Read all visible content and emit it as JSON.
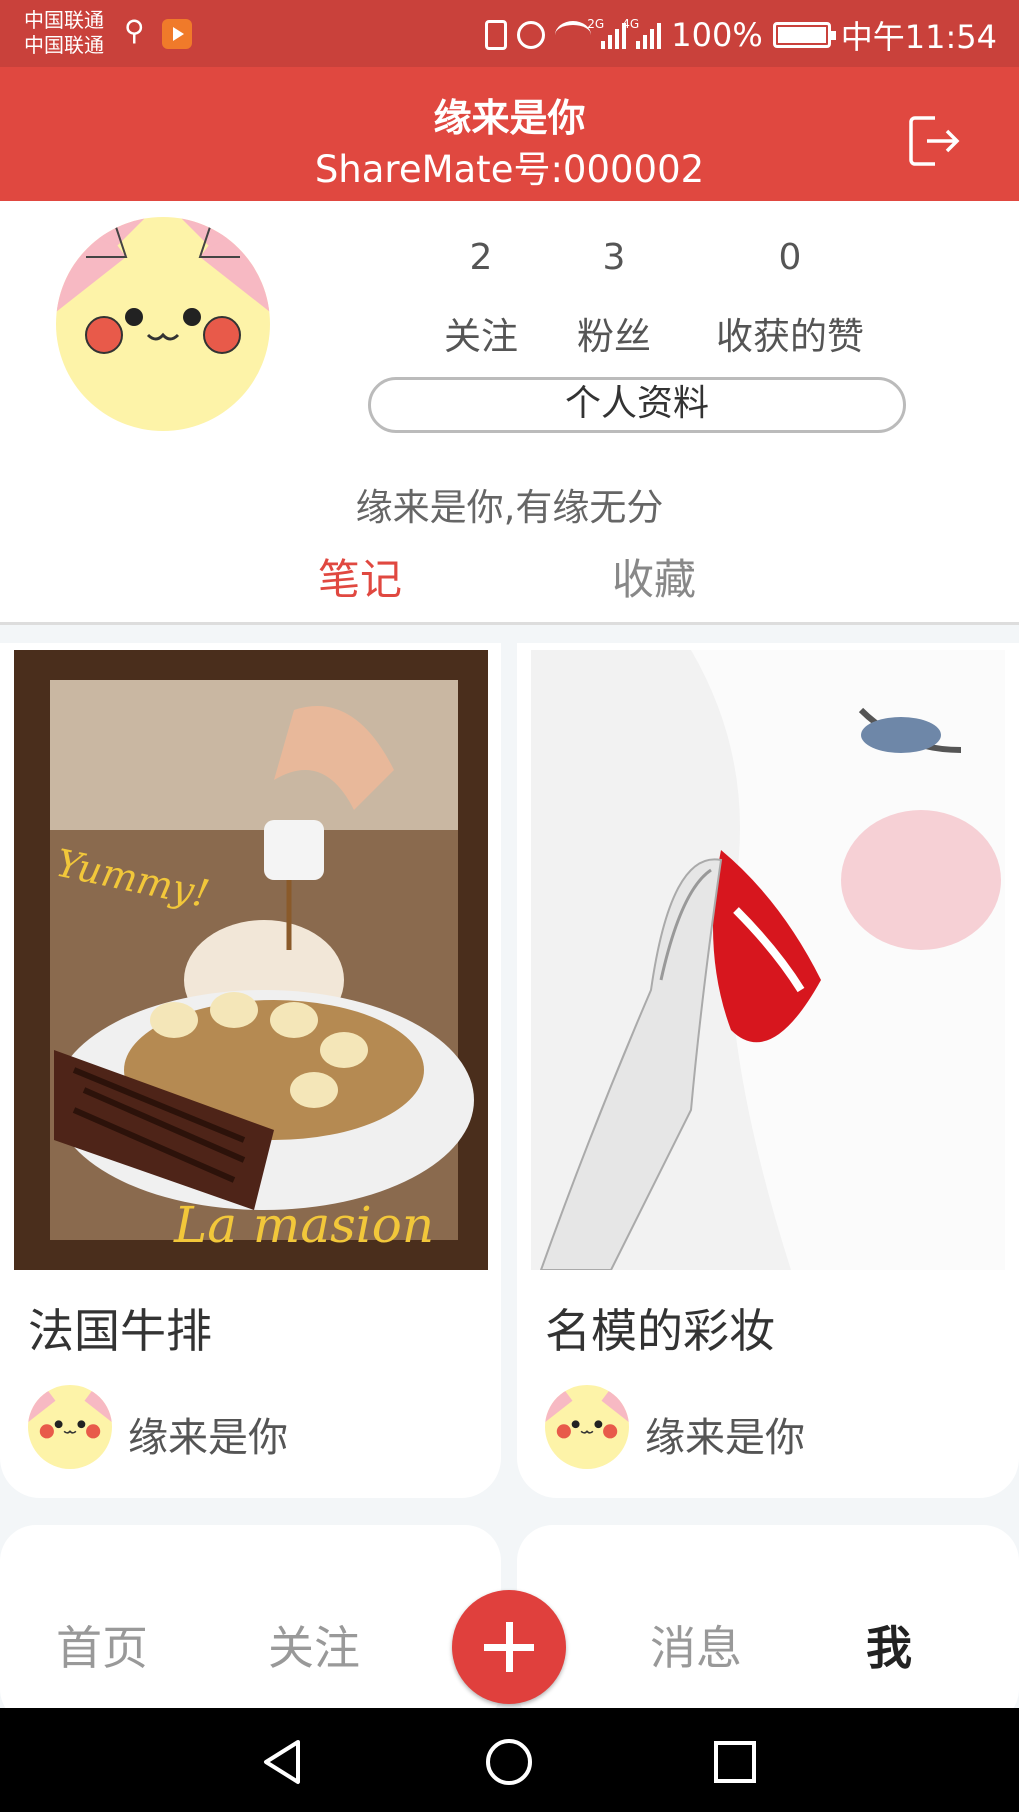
{
  "statusbar": {
    "carrier1": "中国联通",
    "carrier2": "中国联通",
    "net1": "2G",
    "net2": "4G",
    "battery": "100%",
    "time": "中午11:54"
  },
  "header": {
    "title": "缘来是你",
    "id_text": "ShareMate号:000002"
  },
  "profile": {
    "stats": [
      {
        "value": "2",
        "label": "关注"
      },
      {
        "value": "3",
        "label": "粉丝"
      },
      {
        "value": "0",
        "label": "收获的赞"
      }
    ],
    "profile_button": "个人资料",
    "bio": "缘来是你,有缘无分"
  },
  "tabs": {
    "notes": "笔记",
    "favorites": "收藏"
  },
  "cards": [
    {
      "title": "法国牛排",
      "author": "缘来是你",
      "overlay_top": "Yummy!",
      "overlay_bottom": "La masion"
    },
    {
      "title": "名模的彩妆",
      "author": "缘来是你"
    }
  ],
  "bottom_nav": {
    "home": "首页",
    "follow": "关注",
    "messages": "消息",
    "me": "我"
  },
  "colors": {
    "header_red": "#e04840",
    "statusbar_red": "#c9413b",
    "active_tab": "#e04840"
  }
}
